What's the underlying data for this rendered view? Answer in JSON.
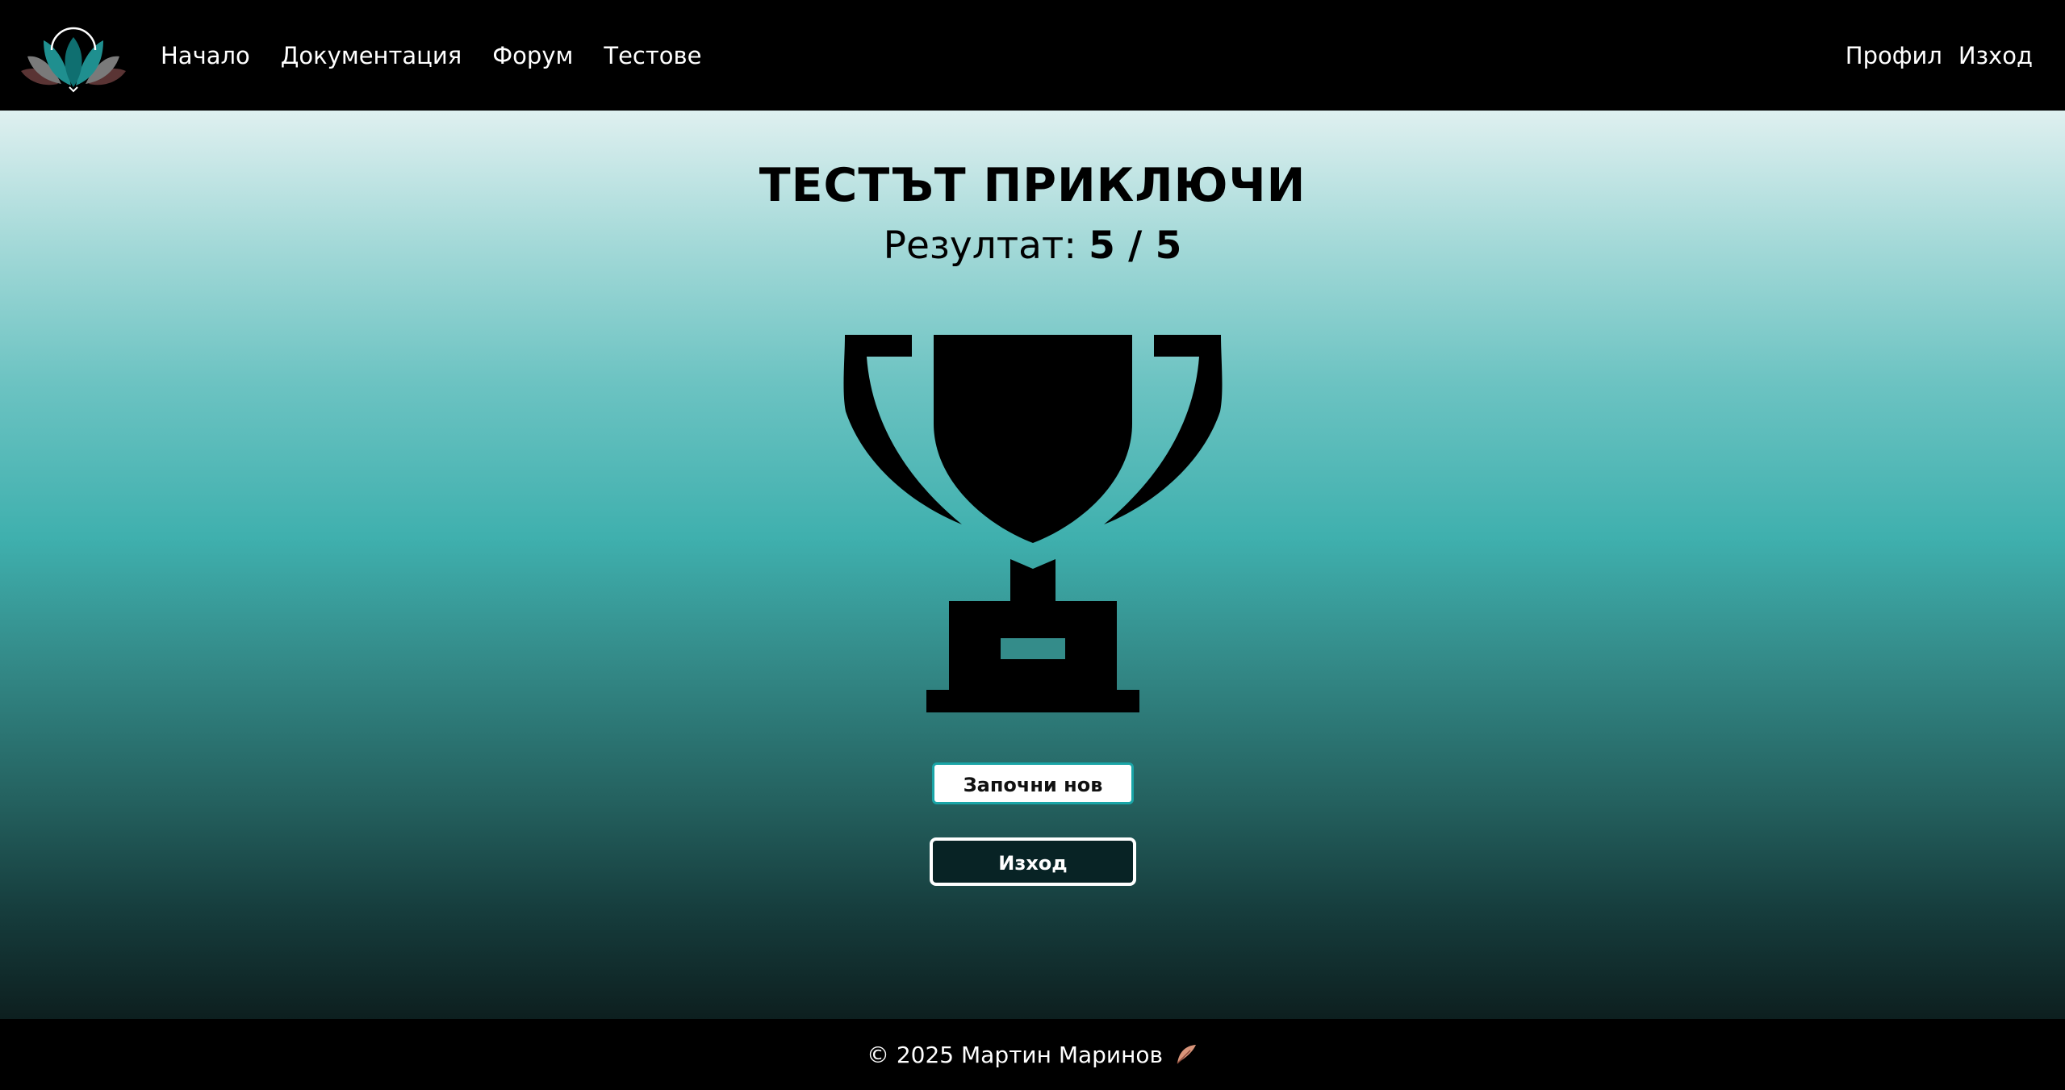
{
  "nav": {
    "items": [
      "Начало",
      "Документация",
      "Форум",
      "Тестове"
    ],
    "profile": "Профил",
    "logout": "Изход"
  },
  "result": {
    "title": "ТЕСТЪТ ПРИКЛЮЧИ",
    "score_label": "Резултат:",
    "score_value": "5 / 5"
  },
  "buttons": {
    "start_new": "Започни нов",
    "exit": "Изход"
  },
  "footer": {
    "text": "© 2025 Мартин Маринов"
  },
  "icons": {
    "logo": "lotus-logo-icon",
    "trophy": "trophy-icon",
    "footer": "feather-icon"
  },
  "colors": {
    "accent": "#3fb0ae",
    "button_border": "#1aa5a7",
    "exit_button_bg": "#082325",
    "bar_bg": "#000000"
  }
}
